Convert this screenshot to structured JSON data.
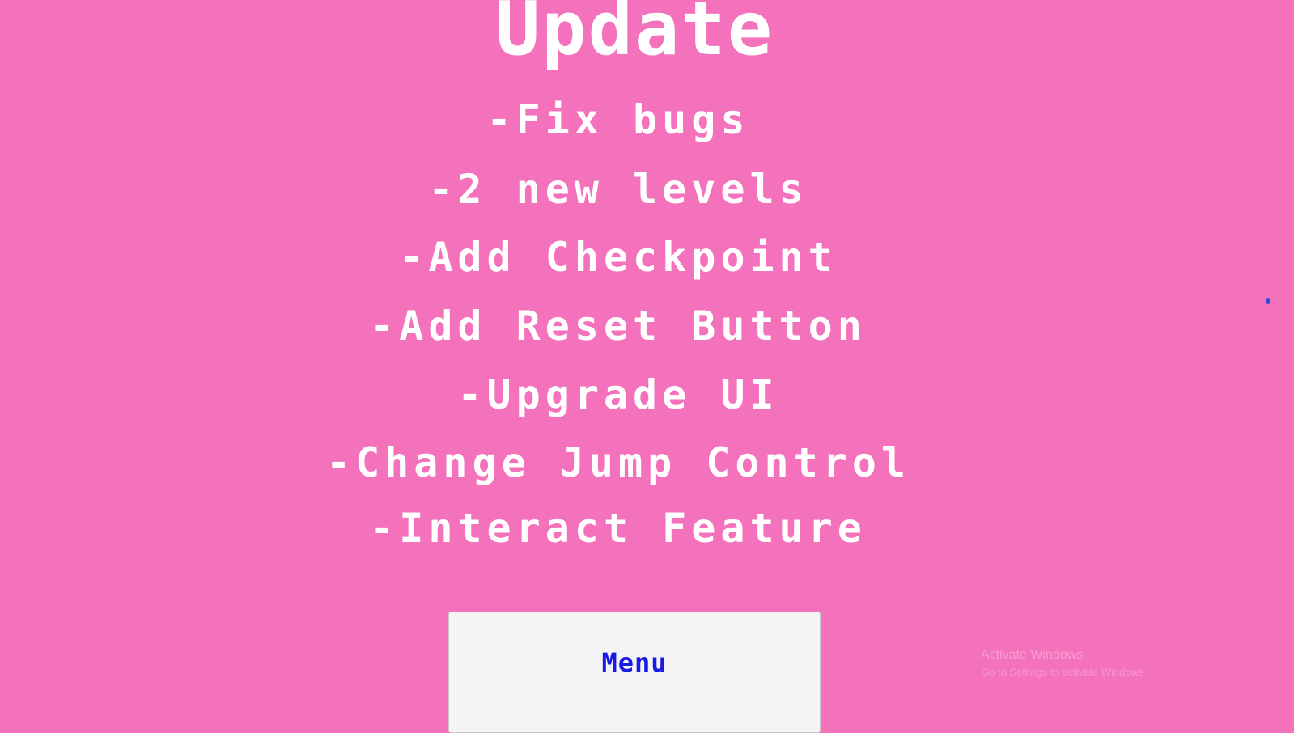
{
  "screen": {
    "title": "Update",
    "background_color": "#f472bb",
    "text_color": "#ffffff"
  },
  "update_list": [
    "-Fix bugs",
    "-2 new levels",
    "-Add Checkpoint",
    "-Add Reset Button",
    "-Upgrade UI",
    "-Change Jump Control",
    "-Interact Feature"
  ],
  "menu_button": {
    "label": "Menu",
    "label_color": "#1a1ae6",
    "background_color": "#f4f4f4"
  },
  "os_watermark": {
    "line1": "Activate Windows",
    "line2": "Go to Settings to activate Windows."
  }
}
